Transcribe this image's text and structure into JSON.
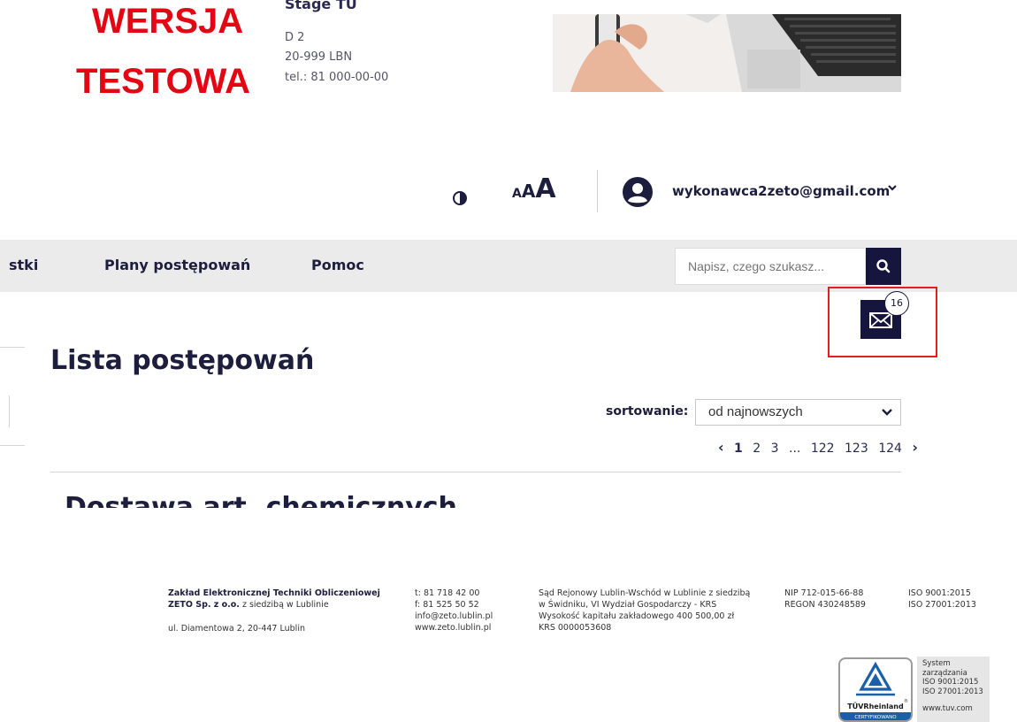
{
  "header": {
    "brand_line1": "WERSJA",
    "brand_line2": "TESTOWA",
    "stage": "Stage TU",
    "address": [
      "D 2",
      "20-999 LBN",
      "tel.: 81 000-00-00"
    ]
  },
  "accessibility": {
    "contrast_icon": "contrast-icon",
    "font_small": "A",
    "font_medium": "A",
    "font_large": "A"
  },
  "user": {
    "icon": "user-circle-icon",
    "email": "wykonawca2zeto@gmail.com",
    "chevron": "⌄"
  },
  "nav": {
    "items": [
      "stki",
      "Plany postępowań",
      "Pomoc"
    ],
    "search_placeholder": "Napisz, czego szukasz...",
    "search_icon": "search-icon"
  },
  "messages": {
    "icon": "envelope-icon",
    "count": "16"
  },
  "main": {
    "title": "Lista postępowań",
    "sort_label": "sortowanie:",
    "sort_value": "od najnowszych",
    "pagination": {
      "prev": "‹",
      "pages": [
        "1",
        "2",
        "3",
        "...",
        "122",
        "123",
        "124"
      ],
      "active": "1",
      "next": "›"
    },
    "first_item_title": "Dostawa art. chemicznych"
  },
  "footer": {
    "company_line1": "Zakład Elektronicznej Techniki Obliczeniowej",
    "company_line2_bold": "ZETO Sp. z o.o.",
    "company_line2_rest": " z siedzibą w Lublinie",
    "company_address": "ul. Diamentowa 2, 20-447 Lublin",
    "phone": "t: 81 718 42 00",
    "fax": "f: 81 525 50 52",
    "email": "info@zeto.lublin.pl",
    "www": "www.zeto.lublin.pl",
    "court_line1": "Sąd Rejonowy Lublin-Wschód w Lublinie z siedzibą",
    "court_line2": "w Świdniku, VI Wydział Gospodarczy - KRS",
    "court_line3": "Wysokość kapitału zakładowego 400 500,00 zł",
    "court_line4": "KRS 0000053608",
    "nip": "NIP 712-015-66-88",
    "regon": "REGON 430248589",
    "iso1": "ISO 9001:2015",
    "iso2": "ISO 27001:2013",
    "cert": {
      "brand": "TÜVRheinland",
      "registered": "®",
      "badge": "CERTYFIKOWANO",
      "lines": [
        "System",
        "zarządzania",
        "ISO 9001:2015",
        "ISO 27001:2013"
      ],
      "url": "www.tuv.com"
    }
  }
}
